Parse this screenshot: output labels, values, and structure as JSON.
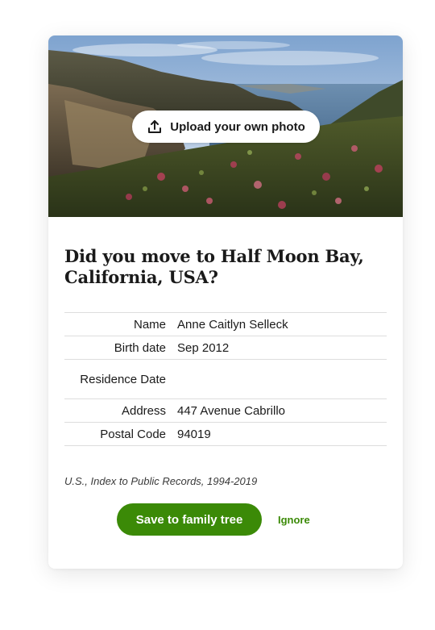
{
  "hero": {
    "upload_label": "Upload your own photo",
    "upload_icon": "upload-icon"
  },
  "question": "Did you move to Half Moon Bay, California, USA?",
  "details": [
    {
      "label": "Name",
      "value": "Anne Caitlyn Selleck"
    },
    {
      "label": "Birth date",
      "value": "Sep 2012"
    },
    {
      "label": "Residence Date",
      "value": ""
    },
    {
      "label": "Address",
      "value": "447 Avenue Cabrillo"
    },
    {
      "label": "Postal Code",
      "value": "94019"
    }
  ],
  "source": "U.S., Index to Public Records, 1994-2019",
  "actions": {
    "save_label": "Save to family tree",
    "ignore_label": "Ignore"
  },
  "colors": {
    "accent": "#3b8a07",
    "divider": "#dddddd"
  }
}
